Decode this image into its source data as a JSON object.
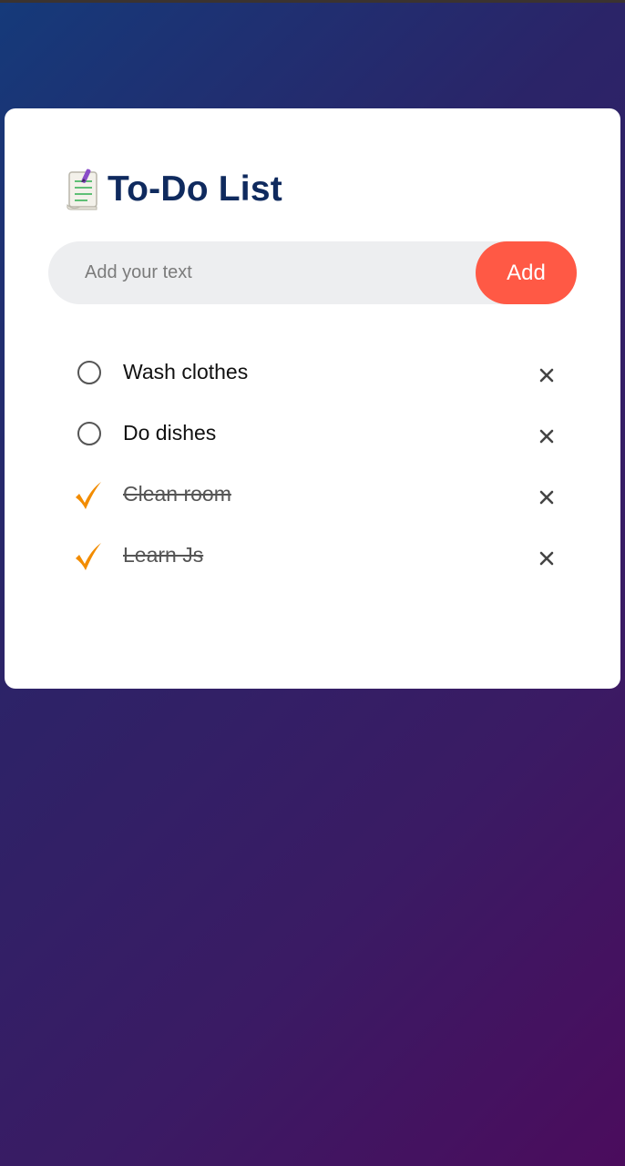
{
  "app": {
    "title": "To-Do List",
    "title_icon": "notepad-icon"
  },
  "input": {
    "placeholder": "Add your text",
    "value": ""
  },
  "add_button": {
    "label": "Add"
  },
  "tasks": [
    {
      "text": "Wash clothes",
      "done": false
    },
    {
      "text": "Do dishes",
      "done": false
    },
    {
      "text": "Clean room",
      "done": true
    },
    {
      "text": "Learn Js",
      "done": true
    }
  ],
  "colors": {
    "title": "#0f2a5e",
    "add_button": "#ff5945",
    "input_background": "#edeef0",
    "check_mark": "#f28c00",
    "background_start": "#153a7a",
    "background_end": "#4b0c5d"
  }
}
